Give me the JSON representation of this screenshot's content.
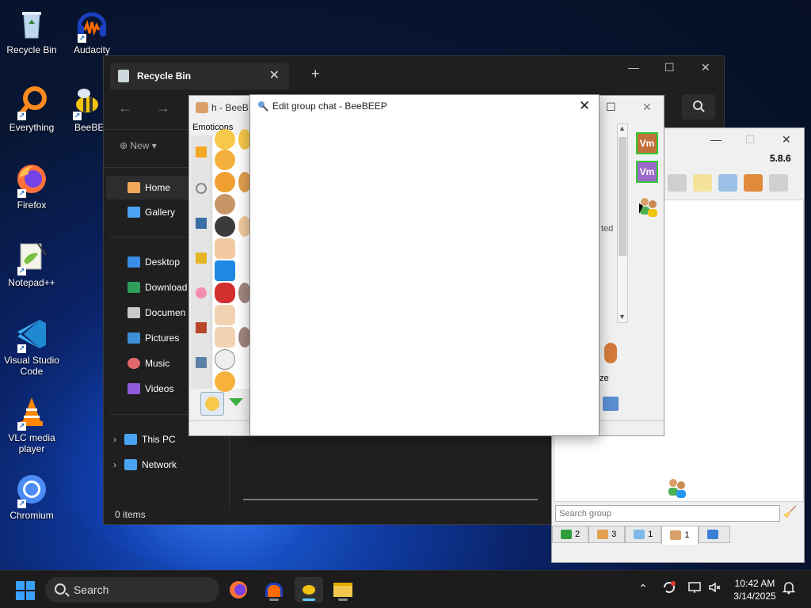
{
  "desktop": {
    "icons": [
      {
        "label": "Recycle Bin"
      },
      {
        "label": "Audacity"
      },
      {
        "label": "Everything"
      },
      {
        "label": "BeeBEEP"
      },
      {
        "label": "Firefox"
      },
      {
        "label": "Notepad++"
      },
      {
        "label": "Visual Studio Code"
      },
      {
        "label": "VLC media player"
      },
      {
        "label": "Chromium"
      }
    ]
  },
  "explorer": {
    "tab_title": "Recycle Bin",
    "new_label": "New",
    "nav": {
      "home": "Home",
      "gallery": "Gallery",
      "desktop": "Desktop",
      "downloads": "Download",
      "documents": "Documen",
      "pictures": "Pictures",
      "music": "Music",
      "videos": "Videos",
      "this_pc": "This PC",
      "network": "Network"
    },
    "status": "0 items"
  },
  "beebeep_chat": {
    "title_partial": "h - BeeB",
    "emoticons_label": "Emoticons",
    "partial_status": "ted",
    "partial_label": "ze",
    "vm_label": "Vm"
  },
  "beebeep_main": {
    "version": "5.8.6",
    "search_placeholder": "Search group",
    "tabs": [
      {
        "count": "2"
      },
      {
        "count": "3"
      },
      {
        "count": "1"
      },
      {
        "count": "1"
      },
      {
        "count": ""
      }
    ]
  },
  "dialog": {
    "title": "Edit group chat - BeeBEEP",
    "close_glyph": "✕"
  },
  "taskbar": {
    "search_label": "Search",
    "time": "10:42 AM",
    "date": "3/14/2025"
  },
  "colors": {
    "accent": "#60cdff",
    "explorer_bg": "#1f1f1f",
    "vm_orange": "#c0703a",
    "vm_purple": "#9b6bc9"
  }
}
